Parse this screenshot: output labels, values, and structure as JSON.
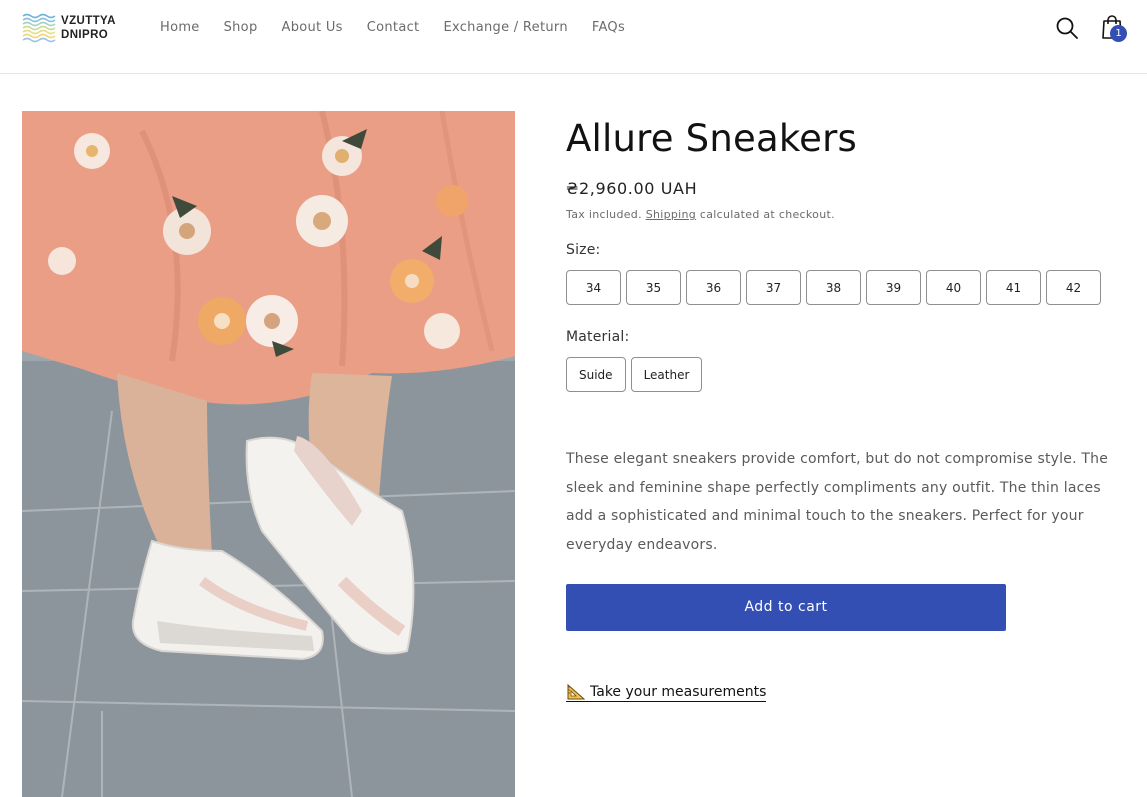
{
  "brand": {
    "logo_text_line1": "VZUTTYA",
    "logo_text_line2": "DNIPRO",
    "logo_icon": "waves-logo"
  },
  "nav": {
    "items": [
      "Home",
      "Shop",
      "About Us",
      "Contact",
      "Exchange / Return",
      "FAQs"
    ]
  },
  "header_icons": {
    "search": "search-icon",
    "cart": "cart-icon",
    "cart_count": "1"
  },
  "product": {
    "image_description_icon": "product-photo",
    "title": "Allure Sneakers",
    "price": "₴2,960.00 UAH",
    "tax_prefix": "Tax included.",
    "tax_link": "Shipping",
    "tax_suffix": "calculated at checkout.",
    "size_label": "Size:",
    "sizes": [
      "34",
      "35",
      "36",
      "37",
      "38",
      "39",
      "40",
      "41",
      "42"
    ],
    "material_label": "Material:",
    "materials": [
      "Suide",
      "Leather"
    ],
    "description": "These elegant sneakers provide comfort, but do not compromise style. The sleek and feminine shape perfectly compliments any outfit. The thin laces add a sophisticated and minimal touch to the sneakers. Perfect for your everyday endeavors.",
    "add_to_cart": "Add to cart",
    "measure_link": "Take your measurements",
    "measure_icon": "triangle-ruler-icon"
  },
  "colors": {
    "accent": "#334fb4",
    "text": "#121212",
    "muted": "#6b6b6b",
    "border": "#8f8f8f"
  }
}
